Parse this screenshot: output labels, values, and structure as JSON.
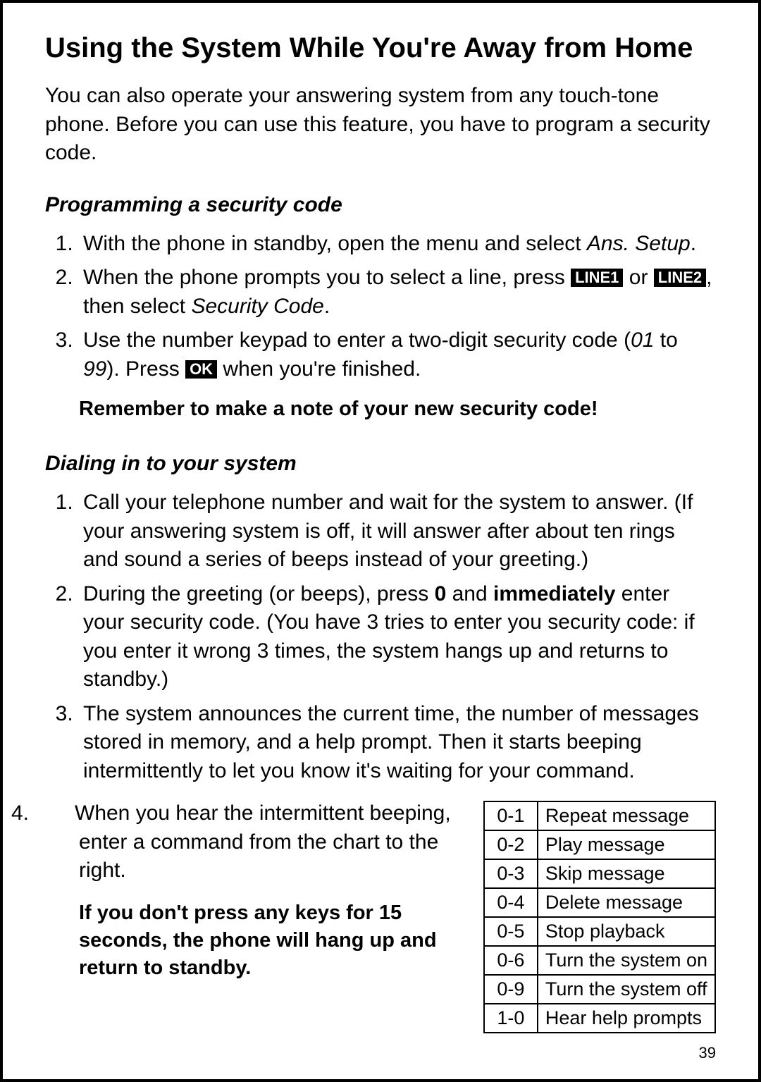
{
  "heading": "Using the System While You're Away from Home",
  "intro": "You can also operate your answering system from any touch-tone phone. Before you can use this feature, you have to program a security code.",
  "section_a": {
    "title": "Programming a security code",
    "steps": {
      "s1_pre": "With the phone in standby, open the menu and select ",
      "s1_menu": "Ans. Setup",
      "s1_post": ".",
      "s2_pre": "When the phone prompts you to select a line, press ",
      "s2_key1": "LINE1",
      "s2_mid": " or ",
      "s2_key2": "LINE2",
      "s2_after": ", then select ",
      "s2_menu": "Security Code",
      "s2_post": ".",
      "s3_pre": "Use the number keypad to enter a two-digit security code (",
      "s3_r1": "01",
      "s3_mid": " to ",
      "s3_r2": "99",
      "s3_after": "). Press ",
      "s3_key": "OK",
      "s3_post": " when you're finished."
    },
    "note": "Remember to make a note of your new security code!"
  },
  "section_b": {
    "title": "Dialing in to your system",
    "steps": {
      "s1": "Call your telephone number and wait for the system to answer. (If your answering system is off, it will answer after about ten rings and sound a series of beeps instead of your greeting.)",
      "s2_pre": "During the greeting (or beeps), press ",
      "s2_key": "0",
      "s2_mid": " and ",
      "s2_strong": "immediately",
      "s2_post": " enter your security code. (You have 3 tries to enter you security code: if you enter it wrong 3 times, the system hangs up and returns to standby.)",
      "s3": "The system announces the current time, the number of messages stored in memory, and a help prompt. Then it starts beeping intermittently to let you know it's waiting for your command.",
      "s4_num": "4.",
      "s4": "When you hear the intermittent beeping, enter a command from the chart to the right.",
      "warn": "If you don't press any keys for 15 seconds, the phone will hang up and return to standby."
    }
  },
  "commands": [
    {
      "code": "0-1",
      "label": "Repeat message"
    },
    {
      "code": "0-2",
      "label": "Play message"
    },
    {
      "code": "0-3",
      "label": "Skip message"
    },
    {
      "code": "0-4",
      "label": "Delete message"
    },
    {
      "code": "0-5",
      "label": "Stop playback"
    },
    {
      "code": "0-6",
      "label": "Turn the system on"
    },
    {
      "code": "0-9",
      "label": "Turn the system off"
    },
    {
      "code": "1-0",
      "label": "Hear help prompts"
    }
  ],
  "page_number": "39"
}
